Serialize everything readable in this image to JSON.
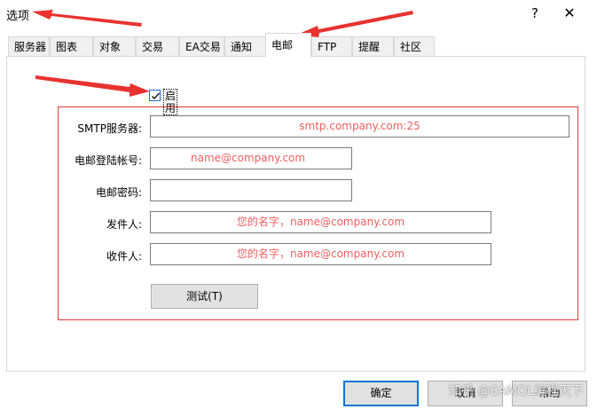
{
  "window": {
    "title": "选项",
    "help_glyph": "?",
    "close_glyph": "✕"
  },
  "tabs": [
    {
      "label": "服务器"
    },
    {
      "label": "图表"
    },
    {
      "label": "对象"
    },
    {
      "label": "交易"
    },
    {
      "label": "EA交易"
    },
    {
      "label": "通知"
    },
    {
      "label": "电邮",
      "active": true
    },
    {
      "label": "FTP"
    },
    {
      "label": "提醒"
    },
    {
      "label": "社区"
    }
  ],
  "email": {
    "enable_label": "启用",
    "enabled": true,
    "smtp_server_label": "SMTP服务器:",
    "smtp_server_value": "smtp.company.com:25",
    "login_label": "电邮登陆帐号:",
    "login_value": "name@company.com",
    "password_label": "电邮密码:",
    "password_value": "",
    "from_label": "发件人:",
    "from_value": "您的名字，name@company.com",
    "to_label": "收件人:",
    "to_value": "您的名字，name@company.com",
    "test_button": "测试(T)"
  },
  "buttons": {
    "ok": "确定",
    "cancel": "取消",
    "help": "帮助"
  },
  "watermark": "知乎 @EAMQL编程天下",
  "colors": {
    "annotation_red": "#e53939",
    "arrow_red": "#e8322f",
    "placeholder_text": "#f06060",
    "default_button_border": "#0078d7"
  }
}
